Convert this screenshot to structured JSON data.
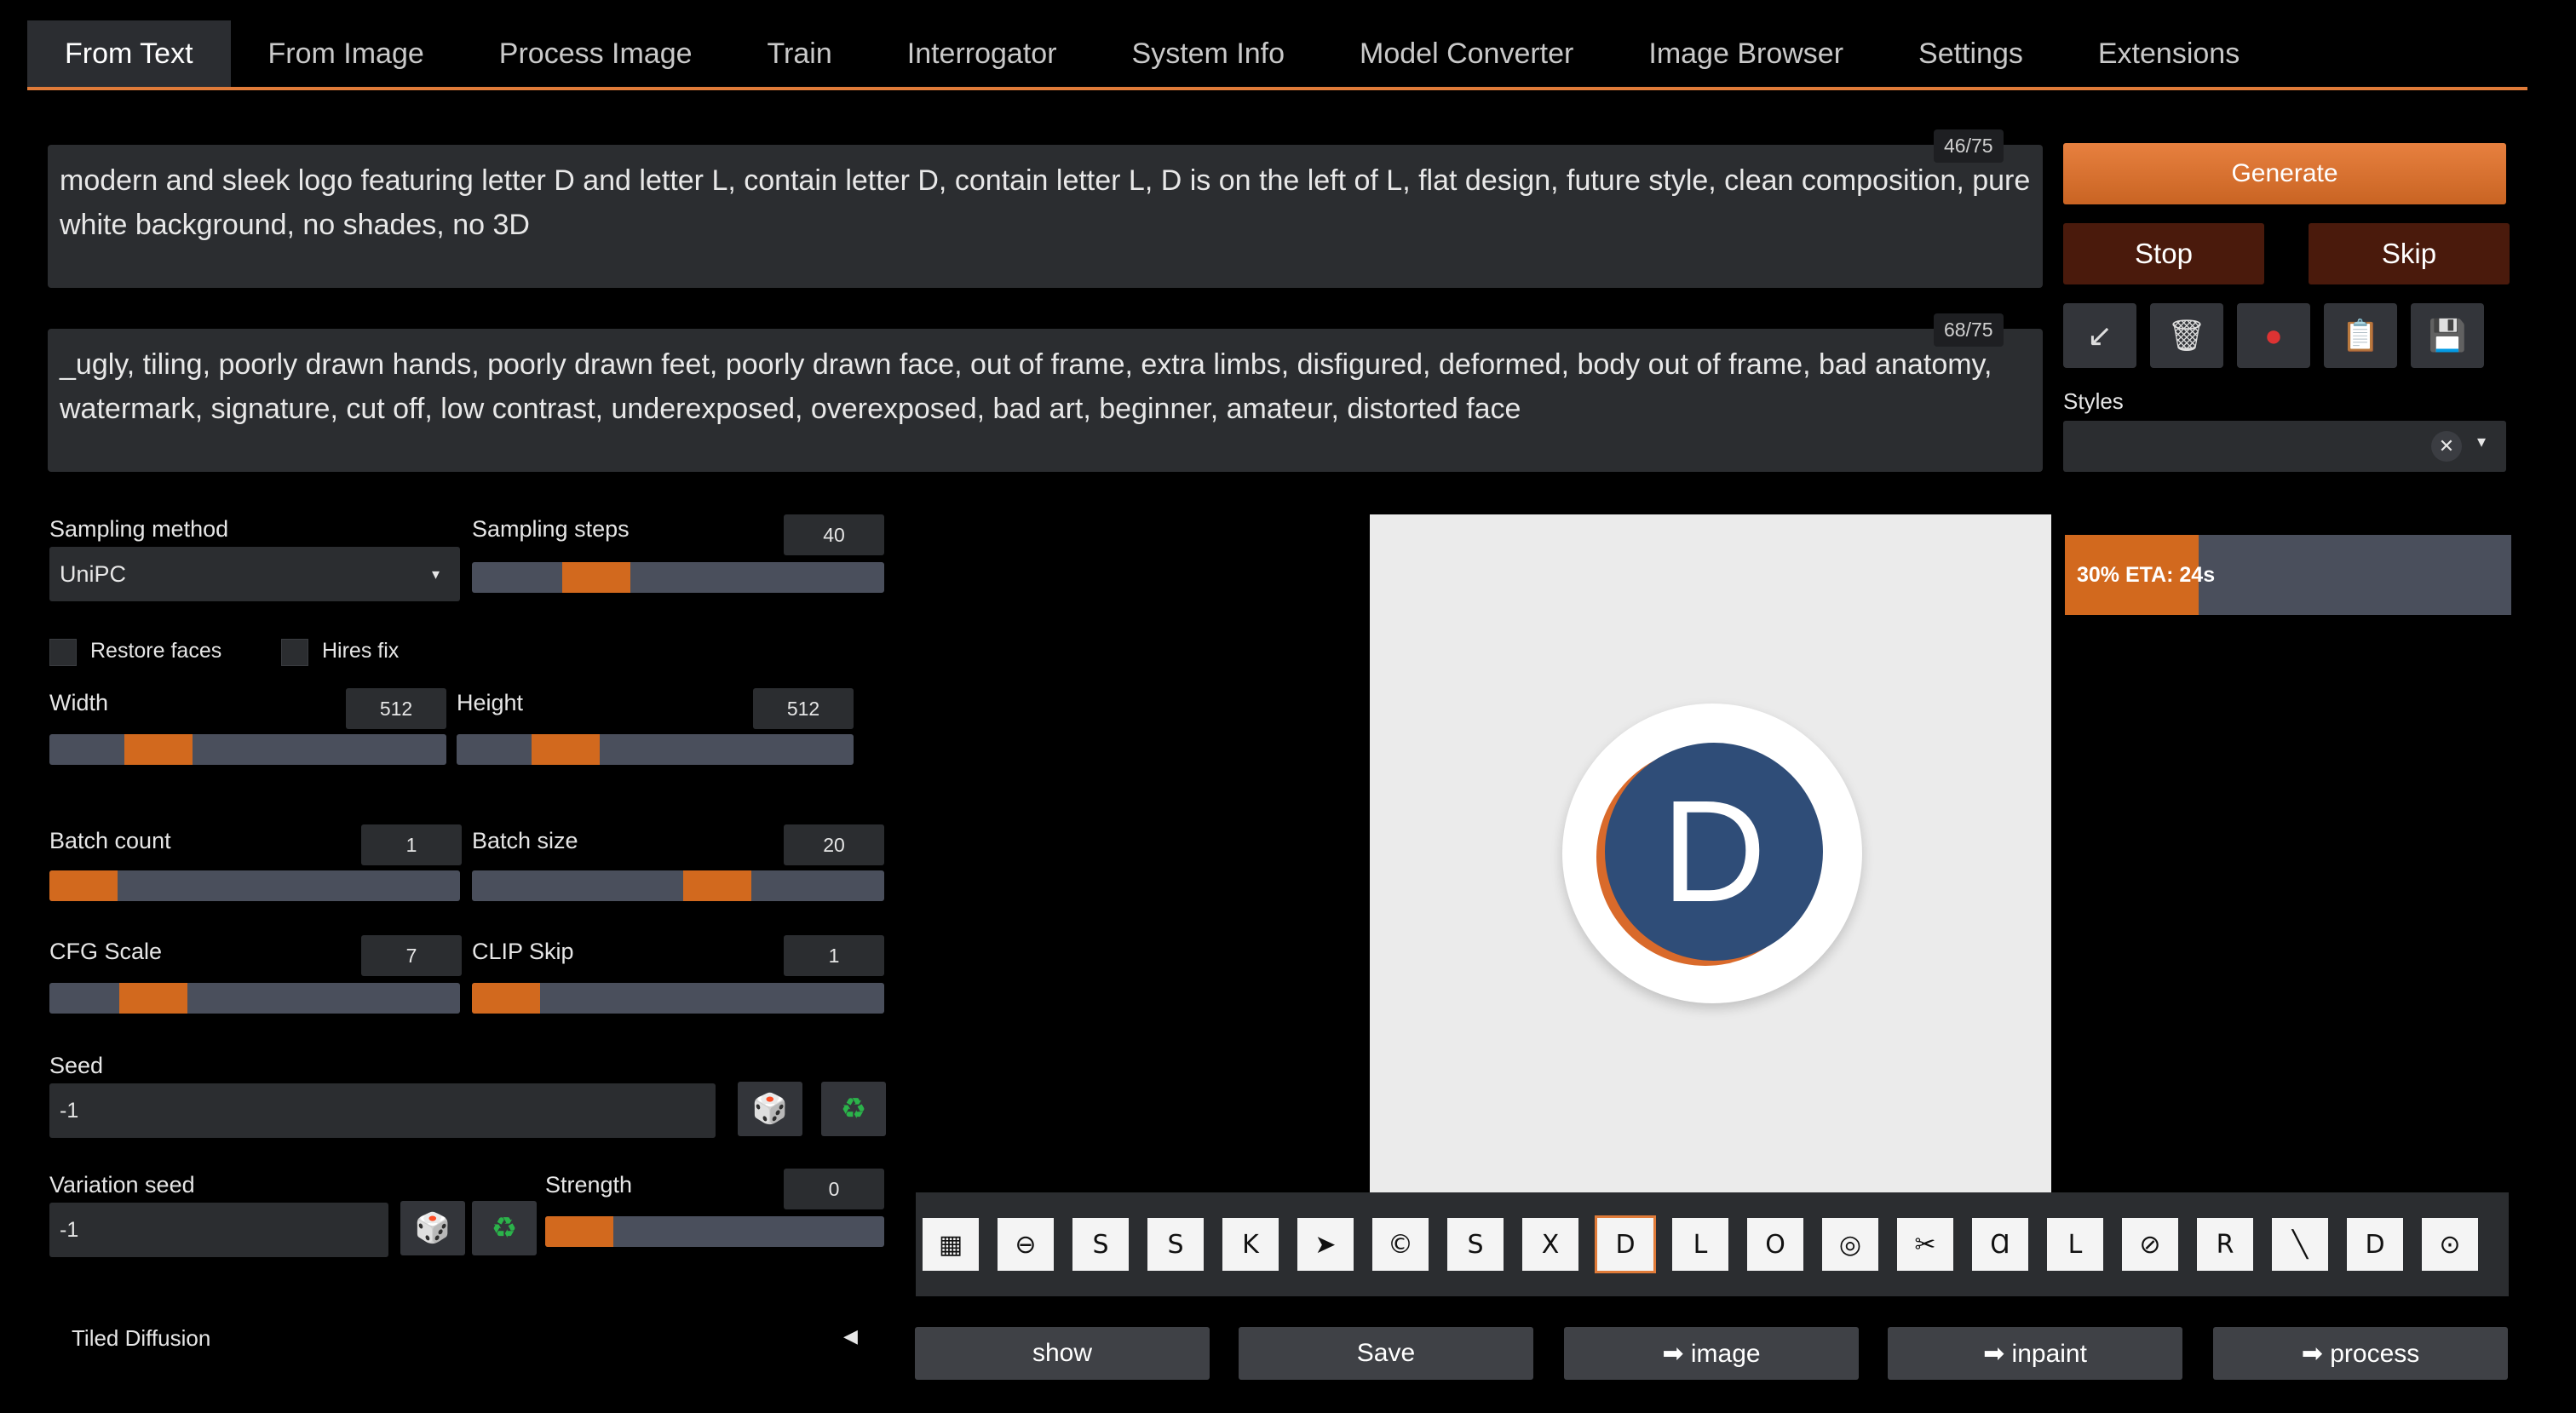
{
  "tabs": [
    "From Text",
    "From Image",
    "Process Image",
    "Train",
    "Interrogator",
    "System Info",
    "Model Converter",
    "Image Browser",
    "Settings",
    "Extensions"
  ],
  "prompt": {
    "text": "modern and sleek logo featuring letter D and letter L,  contain letter D, contain letter L, D is on the left of L, flat design, future style, clean composition, pure white background, no shades, no 3D",
    "counter": "46/75"
  },
  "negative_prompt": {
    "text": "_ugly, tiling, poorly drawn hands, poorly drawn feet, poorly drawn face, out of frame, extra limbs, disfigured, deformed, body out of frame, bad anatomy, watermark, signature, cut off, low contrast, underexposed, overexposed, bad art, beginner, amateur, distorted face",
    "counter": "68/75"
  },
  "actions": {
    "generate": "Generate",
    "stop": "Stop",
    "skip": "Skip"
  },
  "tools": [
    "↙",
    "🗑",
    "●",
    "📋",
    "💾"
  ],
  "styles": {
    "label": "Styles",
    "clear": "✕",
    "caret": "▾"
  },
  "progress": {
    "text": "30% ETA: 24s",
    "fraction": 0.3
  },
  "sampling": {
    "method_label": "Sampling method",
    "method_value": "UniPC",
    "caret": "▾",
    "steps_label": "Sampling steps",
    "steps_value": "40"
  },
  "checkboxes": {
    "restore_faces": "Restore faces",
    "hires_fix": "Hires fix"
  },
  "size": {
    "width_label": "Width",
    "width_value": "512",
    "height_label": "Height",
    "height_value": "512"
  },
  "batch": {
    "count_label": "Batch count",
    "count_value": "1",
    "size_label": "Batch size",
    "size_value": "20"
  },
  "cfg": {
    "label": "CFG Scale",
    "value": "7"
  },
  "clip": {
    "label": "CLIP Skip",
    "value": "1"
  },
  "seed": {
    "label": "Seed",
    "value": "-1",
    "dice": "🎲",
    "recycle": "♻"
  },
  "variation": {
    "label": "Variation seed",
    "value": "-1",
    "strength_label": "Strength",
    "strength_value": "0"
  },
  "tiled": {
    "label": "Tiled Diffusion",
    "caret": "◀"
  },
  "preview": {
    "letter": "D"
  },
  "thumbnails": [
    "▦",
    "⊖",
    "S",
    "S",
    "K",
    "➤",
    "©",
    "S",
    "X",
    "D",
    "L",
    "O",
    "◎",
    "✂",
    "Ɑ",
    "L",
    "⊘",
    "R",
    "╲",
    "D",
    "⊙"
  ],
  "bottom_buttons": {
    "show": "show",
    "save": "Save",
    "to_image": "➡ image",
    "to_inpaint": "➡ inpaint",
    "to_process": "➡ process"
  },
  "colors": {
    "accent": "#e07b39",
    "panel": "#2b2d30",
    "progress_bg": "#4a4f5c"
  }
}
